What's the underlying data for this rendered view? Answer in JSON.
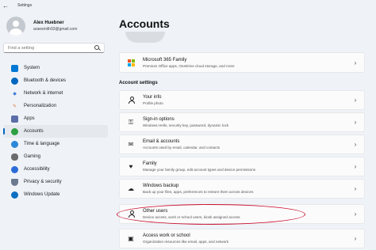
{
  "window": {
    "title": "Settings",
    "back_glyph": "←"
  },
  "profile": {
    "name": "Alex Huebner",
    "email": "araesmith93@gmail.com"
  },
  "search": {
    "placeholder": "Find a setting"
  },
  "nav": [
    {
      "label": "System",
      "icon": "system-icon",
      "color": "#0078d4"
    },
    {
      "label": "Bluetooth & devices",
      "icon": "bluetooth-icon",
      "color": "#0067c0"
    },
    {
      "label": "Network & internet",
      "icon": "wifi-icon",
      "color": "#3d7bd9"
    },
    {
      "label": "Personalization",
      "icon": "brush-icon",
      "color": "#e1793c"
    },
    {
      "label": "Apps",
      "icon": "apps-icon",
      "color": "#5b6ea8"
    },
    {
      "label": "Accounts",
      "icon": "accounts-icon",
      "color": "#2ea043",
      "active": true
    },
    {
      "label": "Time & language",
      "icon": "globe-icon",
      "color": "#2b88d8"
    },
    {
      "label": "Gaming",
      "icon": "gamepad-icon",
      "color": "#6b6b6b"
    },
    {
      "label": "Accessibility",
      "icon": "accessibility-icon",
      "color": "#2b6cd8"
    },
    {
      "label": "Privacy & security",
      "icon": "shield-icon",
      "color": "#6b7a8f"
    },
    {
      "label": "Windows Update",
      "icon": "update-icon",
      "color": "#0a6fc2"
    }
  ],
  "main": {
    "title": "Accounts",
    "ms365": {
      "title": "Microsoft 365 Family",
      "desc": "Premium Office apps, OneDrive cloud storage, and more"
    },
    "section_label": "Account settings",
    "cards": [
      {
        "title": "Your info",
        "desc": "Profile photo",
        "icon": "person-icon"
      },
      {
        "title": "Sign-in options",
        "desc": "Windows Hello, security key, password, dynamic lock",
        "icon": "key-icon"
      },
      {
        "title": "Email & accounts",
        "desc": "Accounts used by email, calendar, and contacts",
        "icon": "mail-icon"
      },
      {
        "title": "Family",
        "desc": "Manage your family group, edit account types and device permissions",
        "icon": "family-icon"
      },
      {
        "title": "Windows backup",
        "desc": "Back up your files, apps, preferences to restore them across devices",
        "icon": "backup-icon"
      },
      {
        "title": "Other users",
        "desc": "Device access, work or school users, kiosk assigned access",
        "icon": "add-user-icon"
      },
      {
        "title": "Access work or school",
        "desc": "Organization resources like email, apps, and network",
        "icon": "briefcase-icon"
      }
    ],
    "chevron": "›"
  },
  "annotation": {
    "color": "#c8102e",
    "target": "Other users"
  }
}
